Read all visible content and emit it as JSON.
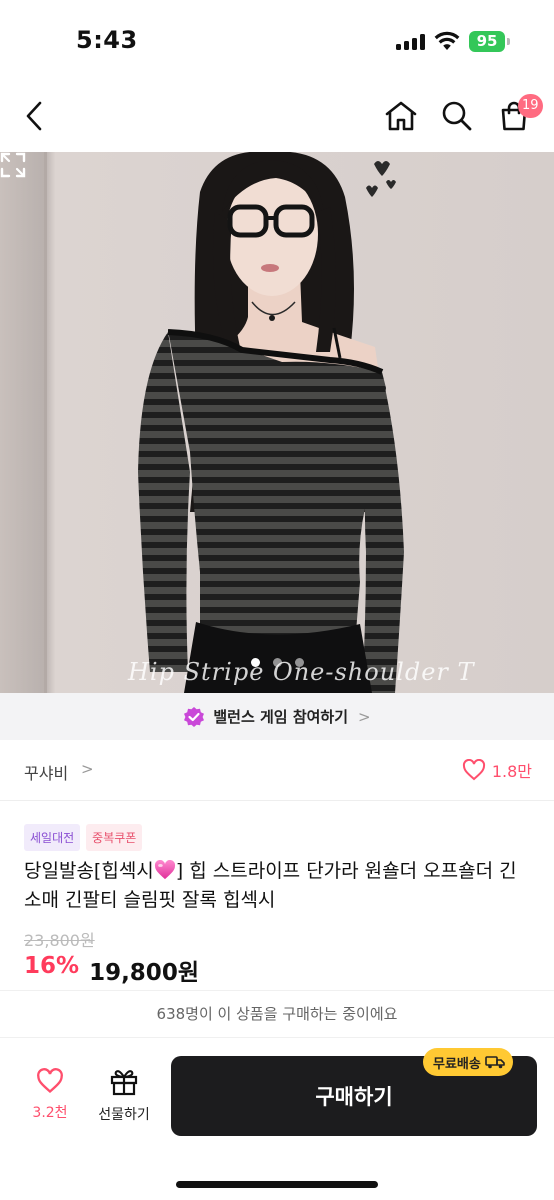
{
  "status_bar": {
    "time": "5:43",
    "battery": "95"
  },
  "nav": {
    "cart_count": "19"
  },
  "hero": {
    "watermark": "Hip Stripe One-shoulder T",
    "page_count": 3,
    "active_page": 1
  },
  "banner": {
    "label": "밸런스 게임 참여하기",
    "chevron": ">"
  },
  "shop": {
    "name": "꾸샤비",
    "chevron": ">",
    "likes": "1.8만"
  },
  "tags": [
    {
      "label": "세일대전"
    },
    {
      "label": "중복쿠폰"
    }
  ],
  "product": {
    "title_before_emoji": "당일발송[힙섹시",
    "title_after_emoji": "] 힙 스트라이프 단가라 원숄더 오프숄더 긴소매 긴팔티 슬림핏 잘록 힙섹시",
    "original_price": "23,800원",
    "discount": "16%",
    "price": "19,800원"
  },
  "notice": {
    "text": "638명이 이 상품을 구매하는 중이에요"
  },
  "bottom_bar": {
    "like_count": "3.2천",
    "gift_label": "선물하기",
    "buy_label": "구매하기",
    "shipping_badge": "무료배송"
  },
  "colors": {
    "accent": "#ff3b5c",
    "buy_button": "#1c1c1e",
    "shipping_badge": "#ffc933",
    "tag_purple": "#8a4fd3",
    "tag_pink": "#e8506c"
  }
}
